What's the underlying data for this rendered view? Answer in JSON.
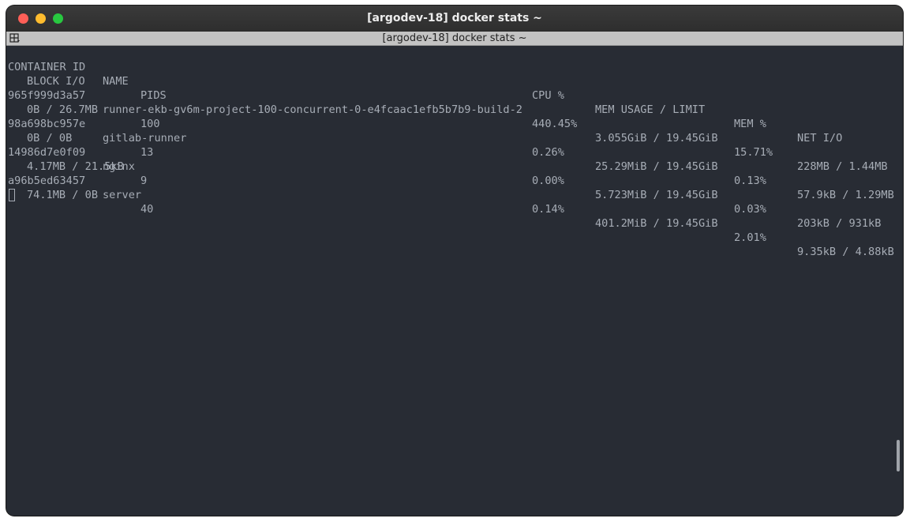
{
  "window": {
    "title": "[argodev-18] docker stats ~",
    "tab_title": "[argodev-18] docker stats ~"
  },
  "icons": {
    "close": "close-icon",
    "minimize": "minimize-icon",
    "maximize": "maximize-icon",
    "tab": "tab-layout-icon"
  },
  "colors": {
    "terminal_bg": "#282c34",
    "terminal_fg": "#a7adb6",
    "close": "#ff5f57",
    "minimize": "#febc2e",
    "maximize": "#28c840"
  },
  "header": {
    "container_id": "CONTAINER ID",
    "name": "NAME",
    "cpu": "CPU %",
    "mem_usage": "MEM USAGE / LIMIT",
    "mem_pct": "MEM %",
    "net_io": "NET I/O",
    "block_io": "BLOCK I/O",
    "pids": "PIDS"
  },
  "rows": [
    {
      "container_id": "965f999d3a57",
      "name": "runner-ekb-gv6m-project-100-concurrent-0-e4fcaac1efb5b7b9-build-2",
      "cpu": "440.45%",
      "mem_usage": "3.055GiB / 19.45GiB",
      "mem_pct": "15.71%",
      "net_io": "228MB / 1.44MB",
      "block_io": "0B / 26.7MB",
      "pids": "100"
    },
    {
      "container_id": "98a698bc957e",
      "name": "gitlab-runner",
      "cpu": "0.26%",
      "mem_usage": "25.29MiB / 19.45GiB",
      "mem_pct": "0.13%",
      "net_io": "57.9kB / 1.29MB",
      "block_io": "0B / 0B",
      "pids": "13"
    },
    {
      "container_id": "14986d7e0f09",
      "name": "nginx",
      "cpu": "0.00%",
      "mem_usage": "5.723MiB / 19.45GiB",
      "mem_pct": "0.03%",
      "net_io": "203kB / 931kB",
      "block_io": "4.17MB / 21.5kB",
      "pids": "9"
    },
    {
      "container_id": "a96b5ed63457",
      "name": "server",
      "cpu": "0.14%",
      "mem_usage": "401.2MiB / 19.45GiB",
      "mem_pct": "2.01%",
      "net_io": "9.35kB / 4.88kB",
      "block_io": "74.1MB / 0B",
      "pids": "40"
    }
  ]
}
